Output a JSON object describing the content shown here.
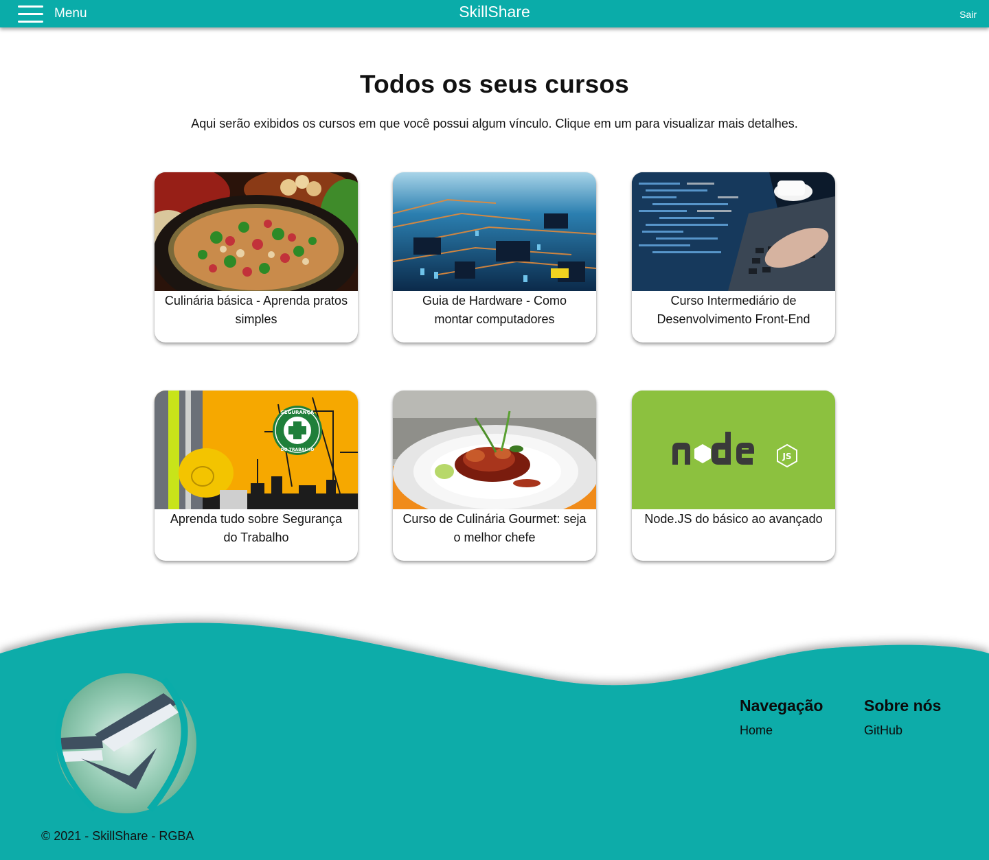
{
  "header": {
    "menu_label": "Menu",
    "brand": "SkillShare",
    "logout_label": "Sair",
    "color": "#0aaca9"
  },
  "main": {
    "title": "Todos os seus cursos",
    "subtitle": "Aqui serão exibidos os cursos em que você possui algum vínculo. Clique em um para visualizar mais detalhes."
  },
  "courses": [
    {
      "title": "Culinária básica - Aprenda pratos simples",
      "image": "food-pan-illustration"
    },
    {
      "title": "Guia de Hardware - Como montar computadores",
      "image": "circuit-board-illustration"
    },
    {
      "title": "Curso Intermediário de Desenvolvimento Front-End",
      "image": "laptop-code-illustration"
    },
    {
      "title": "Aprenda tudo sobre Segurança do Trabalho",
      "image": "safety-helmet-illustration"
    },
    {
      "title": "Curso de Culinária Gourmet: seja o melhor chefe",
      "image": "gourmet-plate-illustration"
    },
    {
      "title": "Node.JS do básico ao avançado",
      "image": "nodejs-logo"
    }
  ],
  "footer": {
    "copyright": "© 2021 - SkillShare - RGBA",
    "navigation": {
      "heading": "Navegação",
      "links": [
        "Home"
      ]
    },
    "about": {
      "heading": "Sobre nós",
      "links": [
        "GitHub"
      ]
    },
    "color": "#0aaca9"
  },
  "images_text": {
    "seguranca_top": "SEGURANÇA",
    "seguranca_bottom": "DO TRABALHO",
    "node_js": "JS"
  }
}
